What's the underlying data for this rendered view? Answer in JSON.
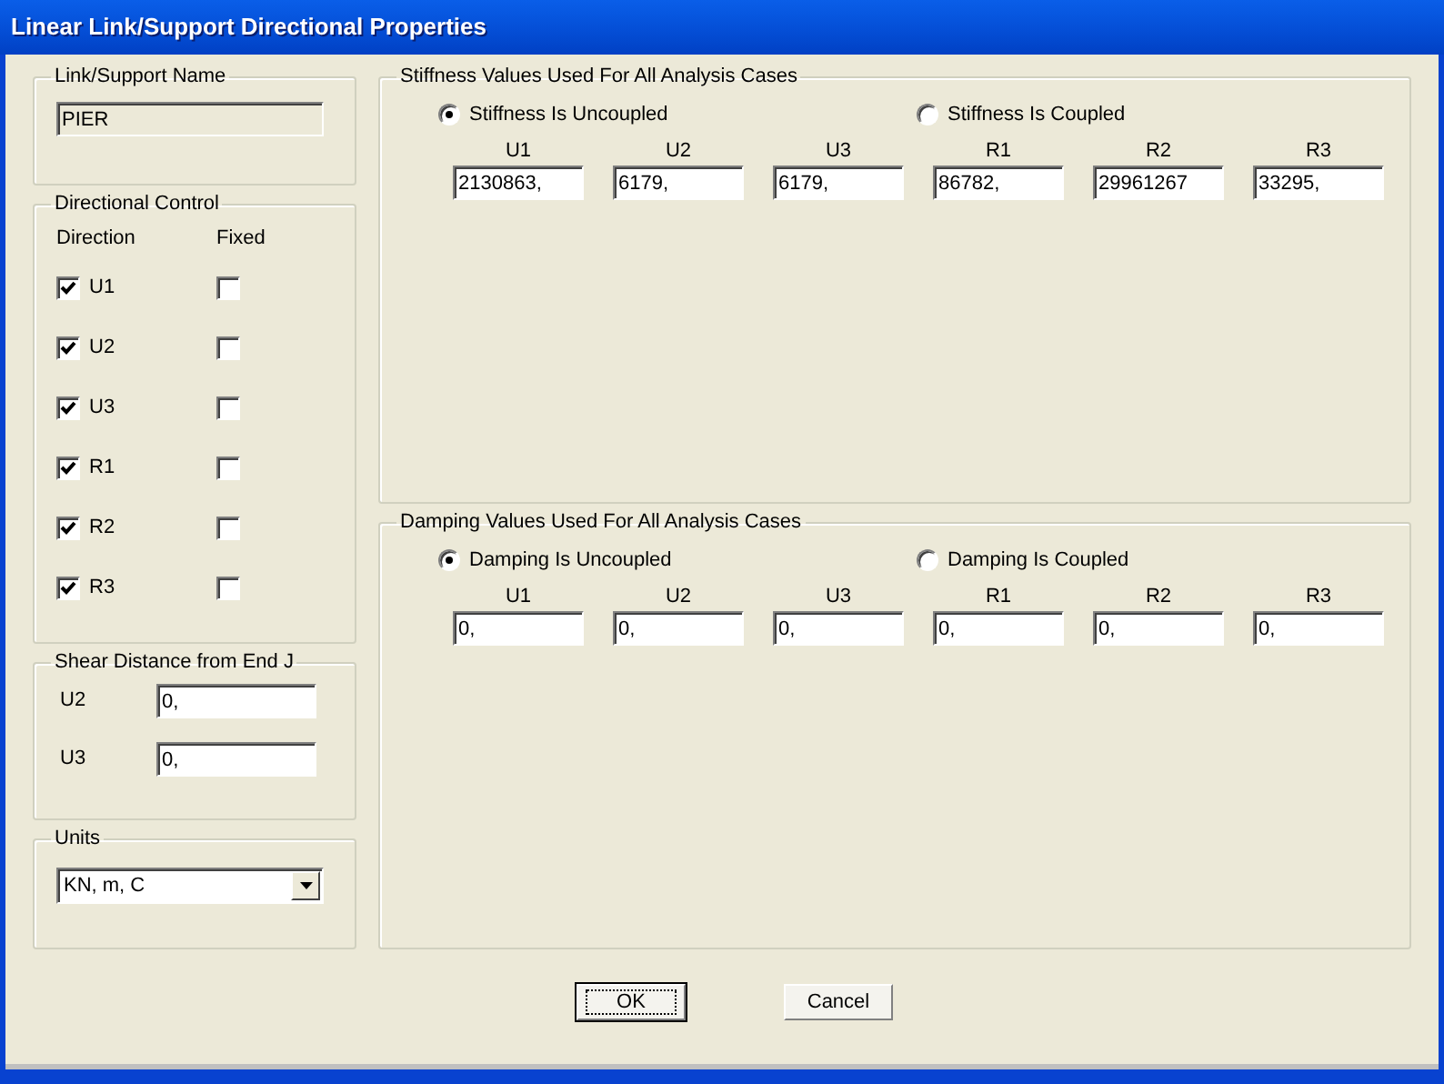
{
  "window": {
    "title": "Linear Link/Support Directional Properties"
  },
  "link_name": {
    "title": "Link/Support Name",
    "value": "PIER"
  },
  "directional_control": {
    "title": "Directional Control",
    "direction_header": "Direction",
    "fixed_header": "Fixed",
    "rows": [
      {
        "label": "U1",
        "checked": true,
        "fixed": false
      },
      {
        "label": "U2",
        "checked": true,
        "fixed": false
      },
      {
        "label": "U3",
        "checked": true,
        "fixed": false
      },
      {
        "label": "R1",
        "checked": true,
        "fixed": false
      },
      {
        "label": "R2",
        "checked": true,
        "fixed": false
      },
      {
        "label": "R3",
        "checked": true,
        "fixed": false
      }
    ]
  },
  "shear_distance": {
    "title": "Shear Distance from End J",
    "rows": [
      {
        "label": "U2",
        "value": "0,"
      },
      {
        "label": "U3",
        "value": "0,"
      }
    ]
  },
  "units": {
    "title": "Units",
    "value": "KN, m, C"
  },
  "stiffness": {
    "title": "Stiffness Values Used For All Analysis Cases",
    "options": [
      {
        "label": "Stiffness Is Uncoupled",
        "selected": true
      },
      {
        "label": "Stiffness Is Coupled",
        "selected": false
      }
    ],
    "columns": [
      {
        "label": "U1",
        "value": "2130863,"
      },
      {
        "label": "U2",
        "value": "6179,"
      },
      {
        "label": "U3",
        "value": "6179,"
      },
      {
        "label": "R1",
        "value": "86782,"
      },
      {
        "label": "R2",
        "value": "29961267"
      },
      {
        "label": "R3",
        "value": "33295,"
      }
    ]
  },
  "damping": {
    "title": "Damping Values Used For All Analysis Cases",
    "options": [
      {
        "label": "Damping Is Uncoupled",
        "selected": true
      },
      {
        "label": "Damping Is Coupled",
        "selected": false
      }
    ],
    "columns": [
      {
        "label": "U1",
        "value": "0,"
      },
      {
        "label": "U2",
        "value": "0,"
      },
      {
        "label": "U3",
        "value": "0,"
      },
      {
        "label": "R1",
        "value": "0,"
      },
      {
        "label": "R2",
        "value": "0,"
      },
      {
        "label": "R3",
        "value": "0,"
      }
    ]
  },
  "buttons": [
    {
      "label": "OK",
      "default": true
    },
    {
      "label": "Cancel",
      "default": false
    }
  ]
}
